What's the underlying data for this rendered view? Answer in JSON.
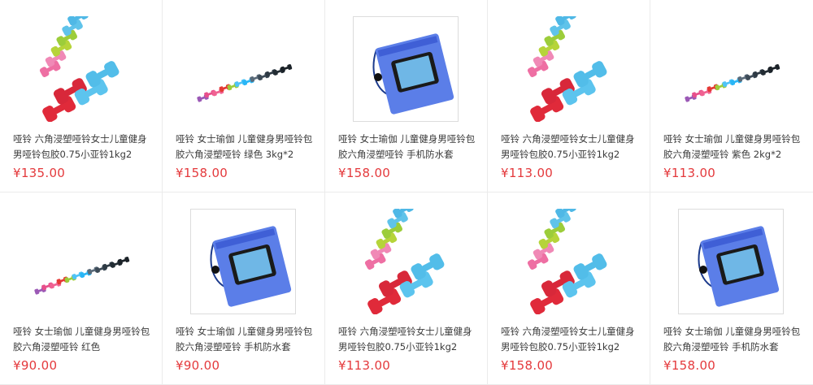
{
  "products": [
    {
      "image": "dumbbell-set-pastel-red-blue",
      "title": "哑铃 六角浸塑哑铃女士儿童健身男哑铃包胶0.75小亚铃1kg2",
      "price": "¥135.00"
    },
    {
      "image": "dumbbell-row-colorful",
      "title": "哑铃 女士瑜伽 儿童健身男哑铃包胶六角浸塑哑铃 绿色 3kg*2",
      "price": "¥158.00"
    },
    {
      "image": "waterproof-phone-pouch",
      "title": "哑铃 女士瑜伽 儿童健身男哑铃包胶六角浸塑哑铃 手机防水套",
      "price": "¥158.00"
    },
    {
      "image": "dumbbell-set-pastel-red-blue",
      "title": "哑铃 六角浸塑哑铃女士儿童健身男哑铃包胶0.75小亚铃1kg2",
      "price": "¥113.00"
    },
    {
      "image": "dumbbell-row-colorful",
      "title": "哑铃 女士瑜伽 儿童健身男哑铃包胶六角浸塑哑铃 紫色 2kg*2",
      "price": "¥113.00"
    },
    {
      "image": "dumbbell-row-colorful",
      "title": "哑铃 女士瑜伽 儿童健身男哑铃包胶六角浸塑哑铃 红色",
      "price": "¥90.00"
    },
    {
      "image": "waterproof-phone-pouch",
      "title": "哑铃 女士瑜伽 儿童健身男哑铃包胶六角浸塑哑铃 手机防水套",
      "price": "¥90.00"
    },
    {
      "image": "dumbbell-set-pastel-red-blue",
      "title": "哑铃 六角浸塑哑铃女士儿童健身男哑铃包胶0.75小亚铃1kg2",
      "price": "¥113.00"
    },
    {
      "image": "dumbbell-set-pastel-red-blue",
      "title": "哑铃 六角浸塑哑铃女士儿童健身男哑铃包胶0.75小亚铃1kg2",
      "price": "¥158.00"
    },
    {
      "image": "waterproof-phone-pouch",
      "title": "哑铃 女士瑜伽 儿童健身男哑铃包胶六角浸塑哑铃 手机防水套",
      "price": "¥158.00"
    }
  ],
  "colors": {
    "price": "#e4393c",
    "title": "#3a3a3a",
    "divider": "#ebebeb"
  }
}
